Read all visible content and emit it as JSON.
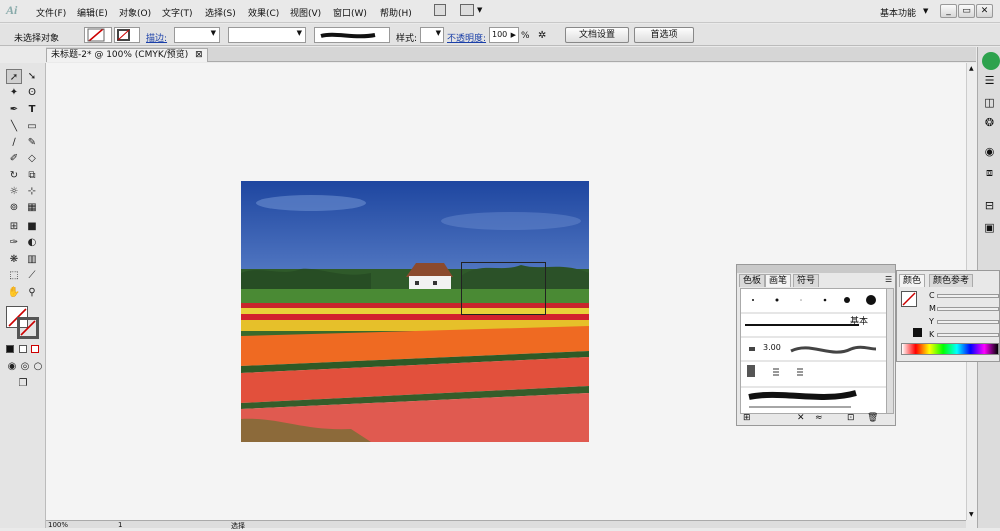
{
  "app": {
    "logo": "Ai"
  },
  "menubar": {
    "items": [
      "文件(F)",
      "编辑(E)",
      "对象(O)",
      "文字(T)",
      "选择(S)",
      "效果(C)",
      "视图(V)",
      "窗口(W)",
      "帮助(H)"
    ],
    "workspace": "基本功能",
    "window_buttons": [
      "_",
      "▭",
      "✕"
    ]
  },
  "controlbar": {
    "selection_status": "未选择对象",
    "stroke_label": "描边:",
    "style_label": "样式:",
    "opacity_label": "不透明度:",
    "opacity_value": "100",
    "opacity_unit": "%",
    "doc_setup_button": "文档设置",
    "preferences_button": "首选项"
  },
  "document": {
    "tab_title": "未标题-2* @ 100% (CMYK/预览)",
    "close_symbol": "⊠"
  },
  "brushes_panel": {
    "tabs": [
      "色板",
      "画笔",
      "符号"
    ],
    "active_tab": "画笔",
    "basic_label": "基本",
    "stroke_weight": "3.00"
  },
  "color_panel": {
    "tabs": [
      "颜色",
      "颜色参考"
    ],
    "channels": [
      "C",
      "M",
      "Y",
      "K"
    ]
  },
  "statusbar": {
    "zoom": "100%",
    "page": "1",
    "mode": "选择"
  },
  "colors": {
    "selection": "#1f1f1f",
    "accent_link": "#1a3fa8"
  }
}
